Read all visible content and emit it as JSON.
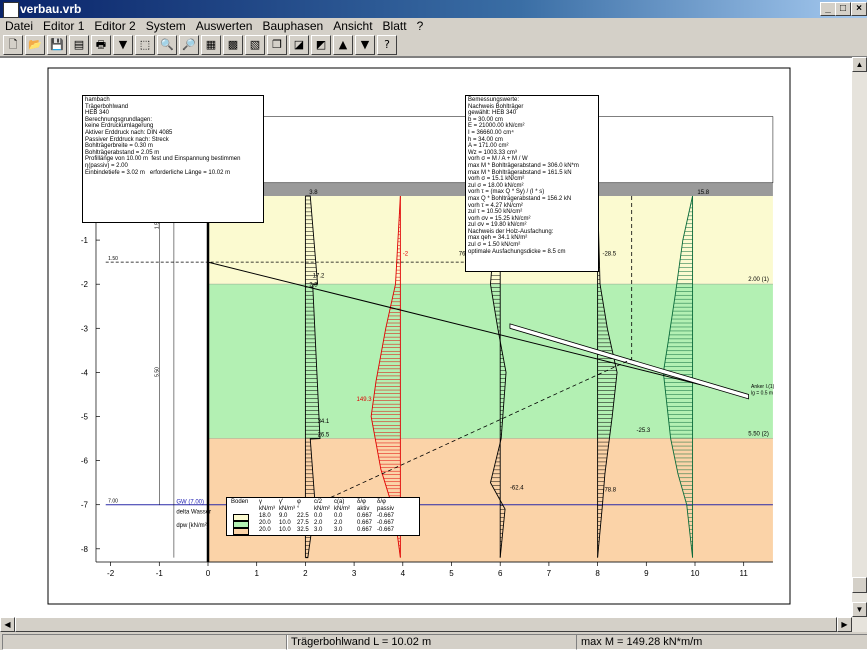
{
  "window": {
    "title": "verbau.vrb",
    "min": "_",
    "max": "□",
    "close": "×"
  },
  "menu": [
    "Datei",
    "Editor 1",
    "Editor 2",
    "System",
    "Auswerten",
    "Bauphasen",
    "Ansicht",
    "Blatt",
    "?"
  ],
  "toolbar": [
    {
      "name": "new-file-icon",
      "glyph": "🗋"
    },
    {
      "name": "open-folder-icon",
      "glyph": "📂"
    },
    {
      "name": "save-icon",
      "glyph": "💾"
    },
    {
      "name": "page-icon",
      "glyph": "▤"
    },
    {
      "name": "print-icon",
      "glyph": "🖶"
    },
    {
      "name": "filter-icon",
      "glyph": "▼"
    },
    {
      "name": "zoom-window-icon",
      "glyph": "⬚"
    },
    {
      "name": "zoom-out-icon",
      "glyph": "🔍"
    },
    {
      "name": "zoom-in-icon",
      "glyph": "🔎"
    },
    {
      "name": "soil-layers-icon",
      "glyph": "▦"
    },
    {
      "name": "table-icon",
      "glyph": "▩"
    },
    {
      "name": "properties-icon",
      "glyph": "▧"
    },
    {
      "name": "copy-icon",
      "glyph": "❐"
    },
    {
      "name": "graph-icon",
      "glyph": "◪"
    },
    {
      "name": "colors-icon",
      "glyph": "◩"
    },
    {
      "name": "arrow-up-icon",
      "glyph": "▲"
    },
    {
      "name": "arrow-down-icon",
      "glyph": "▼"
    },
    {
      "name": "help-icon",
      "glyph": "?"
    }
  ],
  "status": {
    "left": "",
    "middle": "Trägerbohlwand   L = 10.02 m",
    "right": "max M = 149.28 kN*m/m"
  },
  "info_box": {
    "lines": [
      "hambach",
      "Trägerbohlwand",
      "HEB 340",
      "Berechnungsgrundlagen:",
      "keine Erdruckumlagerung",
      "Aktiver Erddruck nach: DIN 4085",
      "Passiver Erddruck nach: Streck",
      "Bohlträgerbreite = 0.30 m",
      "Bohlträgerabstand = 2.05 m",
      "Profillänge von 10.00 m  fest und Einspannung bestimmen",
      "η(passiv) = 2.00",
      "Einbindetiefe = 3.02 m   erforderliche Länge = 10.02 m"
    ]
  },
  "design_box": {
    "lines": [
      "Bemessungswerte:",
      "Nachweis Bohlträger",
      "gewählt: HEB 340",
      "b = 30.00 cm",
      "E = 21000.00 kN/cm²",
      "I = 36660.00 cm⁴",
      "h = 34.00 cm",
      "A = 171.00 cm²",
      "Wz = 1003.33 cm³",
      "vorh σ = M / A + M / W",
      "max M * Bohlträgerabstand = 306.0 kN*m",
      "max M * Bohlträgerabstand = 161.5 kN",
      "vorh σ = 15.1 kN/cm²",
      "zul σ = 18.00 kN/cm²",
      "vorh τ = (max Q * Sy) / (I * s)",
      "max Q * Bohlträgerabstand = 156.2 kN",
      "vorh τ = 4.27 kN/cm²",
      "zul τ = 10.50 kN/cm²",
      "vorh σv = 15.25 kN/cm²",
      "zul σv = 19.80 kN/cm²",
      "Nachweis der Holz-Ausfachung:",
      "max qeh = 34.1 kN/m²",
      "zul σ = 1.50 kN/cm²",
      "optimale Ausfachungsdicke = 8.5 cm"
    ]
  },
  "soil_table": {
    "header1": [
      "Boden",
      "γ",
      "γ'",
      "φ",
      "c/2",
      "c(a)",
      "δ/φ",
      "δ/φ"
    ],
    "header2": [
      "",
      "kN/m³",
      "kN/m³",
      "°",
      "kN/m²",
      "kN/m²",
      "aktiv",
      "passiv"
    ],
    "rows": [
      [
        "18.0",
        "9.0",
        "22.5",
        "0.0",
        "0.0",
        "0.667",
        "-0.667"
      ],
      [
        "20.0",
        "10.0",
        "27.5",
        "2.0",
        "2.0",
        "0.667",
        "-0.667"
      ],
      [
        "20.0",
        "10.0",
        "32.5",
        "3.0",
        "3.0",
        "0.667",
        "-0.667"
      ]
    ],
    "swatch_colors": [
      "#fbfad0",
      "#b3f0b3",
      "#fbd3a8"
    ]
  },
  "axis": {
    "x_ticks": [
      "-2",
      "-1",
      "0",
      "1",
      "2",
      "3",
      "4",
      "5",
      "6",
      "7",
      "8",
      "9",
      "10",
      "11"
    ],
    "y_ticks": [
      "0",
      "-1",
      "-2",
      "-3",
      "-4",
      "-5",
      "-6",
      "-7",
      "-8"
    ]
  },
  "layers": [
    {
      "from": 0.0,
      "to": -2.0,
      "color": "#fbfad0",
      "label": "2.00 (1)"
    },
    {
      "from": -2.0,
      "to": -5.5,
      "color": "#b3f0b3",
      "label": "5.50 (2)"
    },
    {
      "from": -5.5,
      "to": -8.3,
      "color": "#fbd3a8",
      "label": ""
    }
  ],
  "labels": {
    "top_left": "0.00",
    "level_150": "1.50",
    "dim_150": "1.50",
    "dim_550": "5.50",
    "wall_top": "0.00",
    "water_level": "7.00",
    "gw_label": "GW (7.00)",
    "water_note1": "delta Wasser",
    "water_note2": "dpw [kN/m²]",
    "anchor_label1": "Anker I.(1)",
    "anchor_label2": "lg = 0.5 m",
    "v38": "3.8",
    "v172": "17.2",
    "v23": "2.3",
    "v341": "34.1",
    "v265": "26.5",
    "v2": "-2",
    "v1493": "149.3",
    "v762": "76.2",
    "v623": "-62.4",
    "v285": "-28.5",
    "v253": "-25.3",
    "v788": "-78.8",
    "v158": "15.8"
  }
}
